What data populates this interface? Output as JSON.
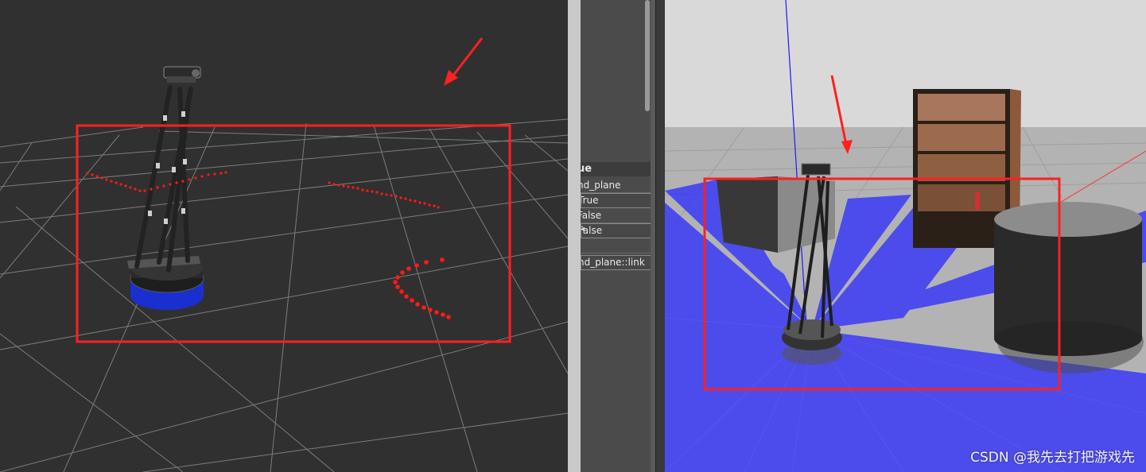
{
  "rviz": {
    "background": "#303030",
    "grid_color": "#8a8a8a",
    "laser_color": "#ff1a1a",
    "robot_base_color": "#1a2fd0"
  },
  "properties": {
    "header": "ue",
    "rows": [
      "nd_plane",
      "True",
      "False",
      "False",
      "",
      "nd_plane::link"
    ]
  },
  "gazebo": {
    "ground_color": "#b9b9b9",
    "sky_color": "#d9d9d9",
    "laser_color": "#2a2aff"
  },
  "annotation": {
    "highlight_color": "#ff2020"
  },
  "watermark": "CSDN @我先去打把游戏先"
}
